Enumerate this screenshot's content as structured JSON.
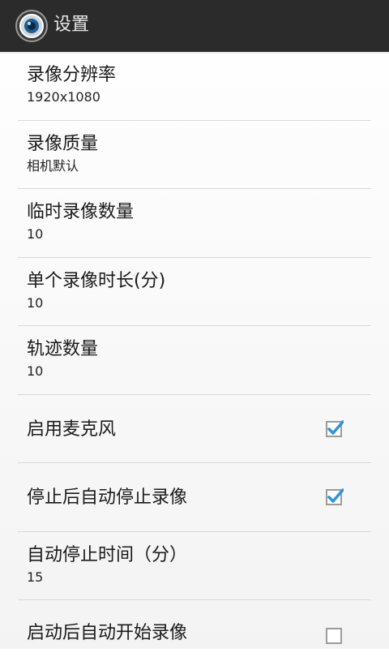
{
  "actionbar": {
    "title": "设置",
    "icon": "camera-lens-icon"
  },
  "settings": [
    {
      "title": "录像分辨率",
      "summary": "1920x1080"
    },
    {
      "title": "录像质量",
      "summary": "相机默认"
    },
    {
      "title": "临时录像数量",
      "summary": "10"
    },
    {
      "title": "单个录像时长(分)",
      "summary": "10"
    },
    {
      "title": "轨迹数量",
      "summary": "10"
    },
    {
      "title": "启用麦克风",
      "checked": true
    },
    {
      "title": "停止后自动停止录像",
      "checked": true
    },
    {
      "title": "自动停止时间（分）",
      "summary": "15"
    },
    {
      "title": "启动后自动开始录像",
      "checked": false
    }
  ],
  "colors": {
    "actionbar_bg": "#2b2b2b",
    "check_accent": "#2f93d6"
  }
}
